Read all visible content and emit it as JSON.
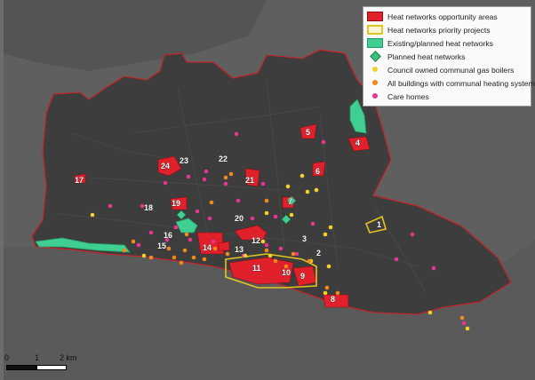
{
  "legend": {
    "items": [
      {
        "label": "Heat networks opportunity areas",
        "symbol": "fill-red"
      },
      {
        "label": "Heat networks priority projects",
        "symbol": "outline-yellow"
      },
      {
        "label": "Existing/planned heat networks",
        "symbol": "fill-green"
      },
      {
        "label": "Planned heat networks",
        "symbol": "green-diamond"
      },
      {
        "label": "Council owned communal gas boilers",
        "symbol": "yellow-dot"
      },
      {
        "label": "All buildings with communal heating systems",
        "symbol": "orange-dot"
      },
      {
        "label": "Care homes",
        "symbol": "pink-dot"
      }
    ]
  },
  "scale_bar": {
    "labels": [
      "0",
      "1",
      "2 km"
    ]
  },
  "area_labels": [
    "1",
    "2",
    "3",
    "4",
    "5",
    "6",
    "7",
    "8",
    "9",
    "10",
    "11",
    "12",
    "13",
    "14",
    "15",
    "16",
    "17",
    "18",
    "19",
    "20",
    "21",
    "22",
    "23",
    "24"
  ],
  "colors": {
    "opportunity": "#e0202a",
    "priority": "#e3c520",
    "network": "#3fcf90",
    "boiler": "#f2d22a",
    "communal": "#f08a1c",
    "carehome": "#e8368f",
    "land": "#3b3b3b",
    "background": "#6b6b6b"
  }
}
